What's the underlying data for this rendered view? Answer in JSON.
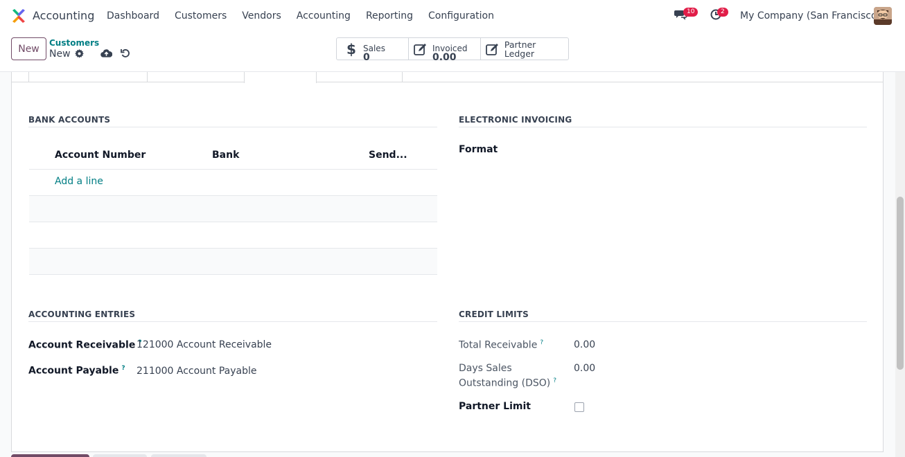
{
  "app": {
    "name": "Accounting",
    "logo_icon": "odoo-accounting-logo"
  },
  "menu": [
    "Dashboard",
    "Customers",
    "Vendors",
    "Accounting",
    "Reporting",
    "Configuration"
  ],
  "systray": {
    "messages_count": "10",
    "activities_count": "2",
    "company": "My Company (San Francisco)"
  },
  "control": {
    "new_label": "New",
    "breadcrumb_parent": "Customers",
    "breadcrumb_current": "New",
    "smart_buttons": {
      "sales": {
        "label": "Sales",
        "value": "0"
      },
      "invoiced": {
        "label": "Invoiced",
        "value": "0.00"
      },
      "ledger": {
        "label": "Partner Ledger"
      }
    }
  },
  "bank_accounts": {
    "title": "BANK ACCOUNTS",
    "columns": [
      "Account Number",
      "Bank",
      "Send..."
    ],
    "add_line": "Add a line"
  },
  "einvoicing": {
    "title": "ELECTRONIC INVOICING",
    "format_label": "Format"
  },
  "accounting_entries": {
    "title": "ACCOUNTING ENTRIES",
    "receivable_label": "Account Receivable",
    "receivable_value": "121000 Account Receivable",
    "payable_label": "Account Payable",
    "payable_value": "211000 Account Payable"
  },
  "credit_limits": {
    "title": "CREDIT LIMITS",
    "total_receivable_label": "Total Receivable",
    "total_receivable_value": "0.00",
    "dso_label_1": "Days Sales",
    "dso_label_2": "Outstanding (DSO)",
    "dso_value": "0.00",
    "partner_limit_label": "Partner Limit"
  },
  "help_mark": "?",
  "colors": {
    "brand": "#714b67",
    "link": "#017e84",
    "badge": "#e11d48"
  }
}
